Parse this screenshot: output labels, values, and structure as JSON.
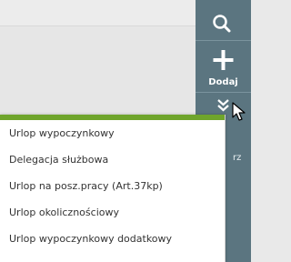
{
  "toolbar": {
    "search": {
      "icon": "search-icon"
    },
    "add": {
      "icon": "plus-icon",
      "label": "Dodaj"
    },
    "more": {
      "icon": "double-chevron-down-icon"
    },
    "hidden_label_fragment": "rz"
  },
  "dropdown": {
    "accent_color": "#6fa52c",
    "items": [
      {
        "label": "Urlop wypoczynkowy"
      },
      {
        "label": "Delegacja służbowa"
      },
      {
        "label": "Urlop na posz.pracy (Art.37kp)"
      },
      {
        "label": "Urlop okolicznościowy"
      },
      {
        "label": "Urlop wypoczynkowy dodatkowy"
      }
    ]
  }
}
